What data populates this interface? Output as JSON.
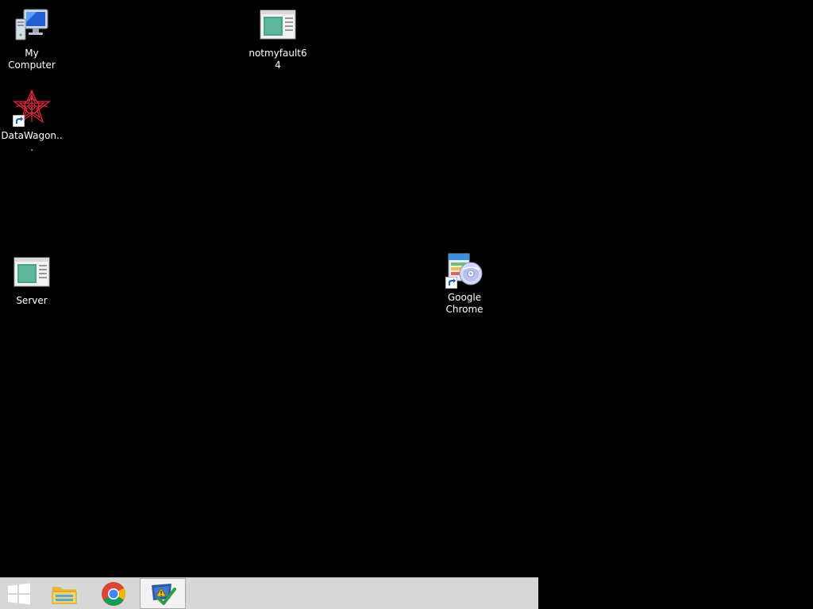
{
  "desktop": {
    "background_color": "#000000",
    "icons": {
      "my_computer": {
        "label": "My Computer",
        "icon": "computer-icon"
      },
      "notmyfault64": {
        "label": "notmyfault64",
        "icon": "application-window-icon"
      },
      "datawagon": {
        "label": "DataWagon...",
        "icon": "datawagon-app-icon",
        "shortcut": true
      },
      "server": {
        "label": "Server",
        "icon": "application-window-icon"
      },
      "google_chrome": {
        "label": "Google Chrome",
        "icon": "installer-disc-icon",
        "shortcut": true
      }
    }
  },
  "taskbar": {
    "background_color": "#d7d7d7",
    "buttons": [
      {
        "name": "start",
        "icon": "windows-logo-icon",
        "active": false
      },
      {
        "name": "file-explorer",
        "icon": "folder-icon",
        "active": false
      },
      {
        "name": "chrome",
        "icon": "chrome-icon",
        "active": false
      },
      {
        "name": "action-center",
        "icon": "action-center-flag-icon",
        "active": true
      }
    ]
  }
}
